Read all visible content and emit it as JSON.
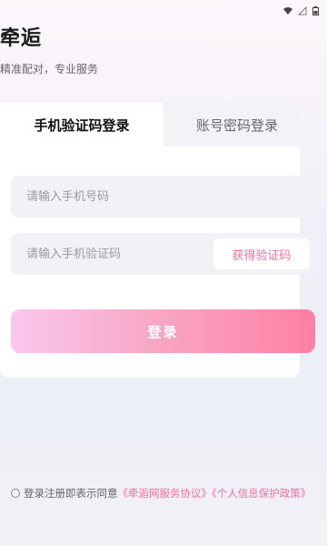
{
  "header": {
    "title": "牵逅",
    "subtitle": "精准配对，专业服务"
  },
  "tabs": {
    "sms_login": "手机验证码登录",
    "password_login": "账号密码登录"
  },
  "form": {
    "phone_placeholder": "请输入手机号码",
    "code_placeholder": "请输入手机验证码",
    "get_code_label": "获得验证码",
    "login_label": "登录"
  },
  "agreement": {
    "prefix": "登录注册即表示同意",
    "service_link": "《牵逅网服务协议》",
    "privacy_link": "《个人信息保护政策》"
  },
  "colors": {
    "accent": "#f0709a",
    "button_start": "#fbc7ef",
    "button_end": "#ff7fa4"
  }
}
